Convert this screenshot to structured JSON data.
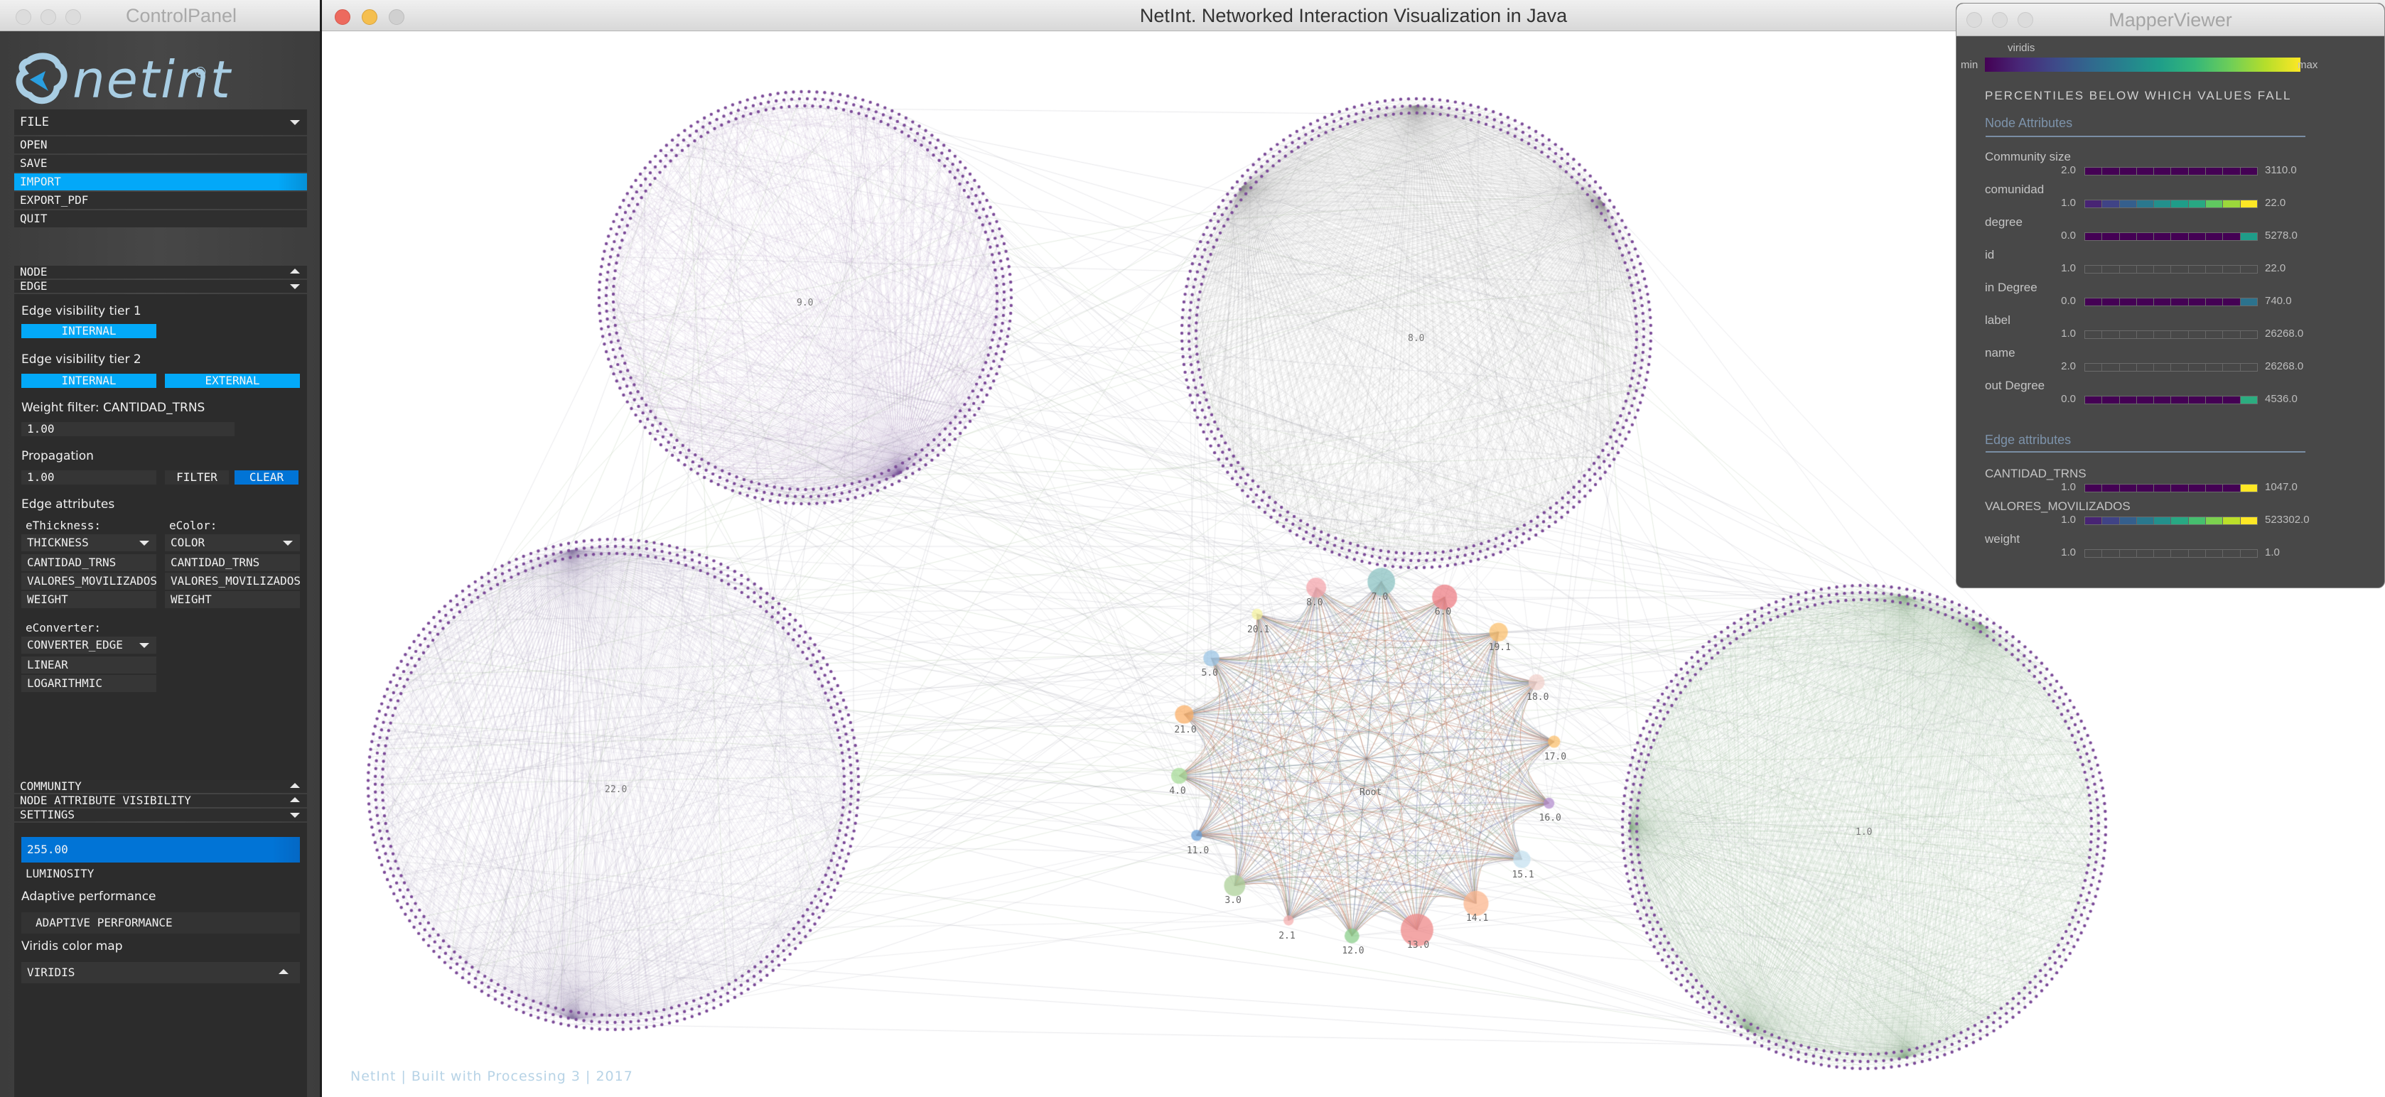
{
  "control_panel": {
    "window_title": "ControlPanel",
    "logo_text": "netint",
    "logo_mark": "®",
    "file_menu": {
      "label": "FILE",
      "items": [
        "OPEN",
        "SAVE",
        "IMPORT",
        "EXPORT_PDF",
        "QUIT"
      ],
      "selected": "IMPORT"
    },
    "sections": {
      "node": "NODE",
      "edge": "EDGE",
      "community": "COMMUNITY",
      "node_attribute_visibility": "NODE ATTRIBUTE VISIBILITY",
      "settings": "SETTINGS"
    },
    "edge": {
      "tier1_label": "Edge visibility tier 1",
      "tier1_buttons": [
        "INTERNAL"
      ],
      "tier2_label": "Edge visibility tier 2",
      "tier2_buttons": [
        "INTERNAL",
        "EXTERNAL"
      ],
      "weight_filter_label": "Weight filter: CANTIDAD_TRNS",
      "weight_filter_value": "1.00",
      "propagation_label": "Propagation",
      "propagation_value": "1.00",
      "filter_button": "FILTER",
      "clear_button": "CLEAR",
      "attributes_label": "Edge attributes",
      "thickness_label": "eThickness:",
      "thickness_dropdown": "THICKNESS",
      "thickness_options": [
        "CANTIDAD_TRNS",
        "VALORES_MOVILIZADOS",
        "WEIGHT"
      ],
      "color_label": "eColor:",
      "color_dropdown": "COLOR",
      "color_options": [
        "CANTIDAD_TRNS",
        "VALORES_MOVILIZADOS",
        "WEIGHT"
      ],
      "converter_label": "eConverter:",
      "converter_dropdown": "CONVERTER_EDGE",
      "converter_options": [
        "LINEAR",
        "LOGARITHMIC"
      ]
    },
    "settings": {
      "luminosity_value": "255.00",
      "luminosity_label": "LUMINOSITY",
      "adaptive_label": "Adaptive performance",
      "adaptive_toggle": "ADAPTIVE PERFORMANCE",
      "viridis_label": "Viridis color map",
      "viridis_dropdown": "VIRIDIS"
    }
  },
  "main_window": {
    "title": "NetInt. Networked Interaction Visualization in Java",
    "footer": "NetInt | Built with Processing 3 | 2017",
    "communities": [
      {
        "label": "9.0",
        "color": "#7a5a9a",
        "hub_angles": [
          62
        ]
      },
      {
        "label": "8.0",
        "color": "#8a8a8a",
        "hub_angles": [
          -90,
          -35,
          220
        ]
      },
      {
        "label": "22.0",
        "color": "#8f7fa8",
        "hub_angles": [
          100,
          -100
        ]
      },
      {
        "label": "1.0",
        "color": "#8fae88",
        "hub_angles": [
          -80,
          -60,
          180,
          80,
          120
        ]
      }
    ],
    "center_cluster": {
      "root_label": "Root",
      "nodes": [
        {
          "label": "20.1",
          "color": "#f6f3a0",
          "size": 0.15
        },
        {
          "label": "8.0",
          "color": "#f4a6ac",
          "size": 0.5
        },
        {
          "label": "7.0",
          "color": "#8cc3c3",
          "size": 0.8
        },
        {
          "label": "6.0",
          "color": "#ee7f86",
          "size": 0.7
        },
        {
          "label": "19.1",
          "color": "#fbc06f",
          "size": 0.45
        },
        {
          "label": "18.0",
          "color": "#f2d2cc",
          "size": 0.35
        },
        {
          "label": "17.0",
          "color": "#fbc06f",
          "size": 0.2
        },
        {
          "label": "16.0",
          "color": "#b48fcf",
          "size": 0.15
        },
        {
          "label": "15.1",
          "color": "#c6e2f0",
          "size": 0.4
        },
        {
          "label": "14.1",
          "color": "#fbb68e",
          "size": 0.7
        },
        {
          "label": "13.0",
          "color": "#ef8a8a",
          "size": 1.0
        },
        {
          "label": "12.0",
          "color": "#8ccf8c",
          "size": 0.3
        },
        {
          "label": "2.1",
          "color": "#f4b0b0",
          "size": 0.12
        },
        {
          "label": "3.0",
          "color": "#aed09a",
          "size": 0.55
        },
        {
          "label": "11.0",
          "color": "#6aa0d8",
          "size": 0.15
        },
        {
          "label": "4.0",
          "color": "#a8dc9a",
          "size": 0.35
        },
        {
          "label": "21.0",
          "color": "#fbb06a",
          "size": 0.45
        },
        {
          "label": "5.0",
          "color": "#9cc6e6",
          "size": 0.35
        }
      ]
    }
  },
  "mapper_viewer": {
    "window_title": "MapperViewer",
    "colormap_name": "viridis",
    "min_label": "min",
    "max_label": "max",
    "heading": "PERCENTILES BELOW WHICH VALUES FALL",
    "node_section": "Node Attributes",
    "edge_section": "Edge attributes",
    "node_attributes": [
      {
        "name": "Community size",
        "min": "2.0",
        "max": "3110.0",
        "deciles": [
          0,
          0,
          0,
          0,
          0,
          0,
          0,
          0,
          0,
          0
        ]
      },
      {
        "name": "comunidad",
        "min": "1.0",
        "max": "22.0",
        "deciles": [
          0.1,
          0.2,
          0.3,
          0.4,
          0.5,
          0.55,
          0.6,
          0.75,
          0.85,
          1.0
        ]
      },
      {
        "name": "degree",
        "min": "0.0",
        "max": "5278.0",
        "deciles": [
          0,
          0,
          0,
          0,
          0,
          0,
          0,
          0,
          0,
          0.55
        ]
      },
      {
        "name": "id",
        "min": "1.0",
        "max": "22.0",
        "deciles": null
      },
      {
        "name": "in Degree",
        "min": "0.0",
        "max": "740.0",
        "deciles": [
          0,
          0,
          0,
          0,
          0,
          0,
          0,
          0,
          0,
          0.38
        ]
      },
      {
        "name": "label",
        "min": "1.0",
        "max": "26268.0",
        "deciles": null
      },
      {
        "name": "name",
        "min": "2.0",
        "max": "26268.0",
        "deciles": null
      },
      {
        "name": "out Degree",
        "min": "0.0",
        "max": "4536.0",
        "deciles": [
          0,
          0,
          0,
          0,
          0,
          0,
          0,
          0,
          0,
          0.62
        ]
      }
    ],
    "edge_attributes": [
      {
        "name": "CANTIDAD_TRNS",
        "min": "1.0",
        "max": "1047.0",
        "deciles": [
          0,
          0,
          0,
          0,
          0,
          0,
          0,
          0,
          0,
          1.0
        ]
      },
      {
        "name": "VALORES_MOVILIZADOS",
        "min": "1.0",
        "max": "523302.0",
        "deciles": [
          0.1,
          0.2,
          0.3,
          0.4,
          0.5,
          0.6,
          0.7,
          0.8,
          0.9,
          1.0
        ]
      },
      {
        "name": "weight",
        "min": "1.0",
        "max": "1.0",
        "deciles": null
      }
    ]
  }
}
